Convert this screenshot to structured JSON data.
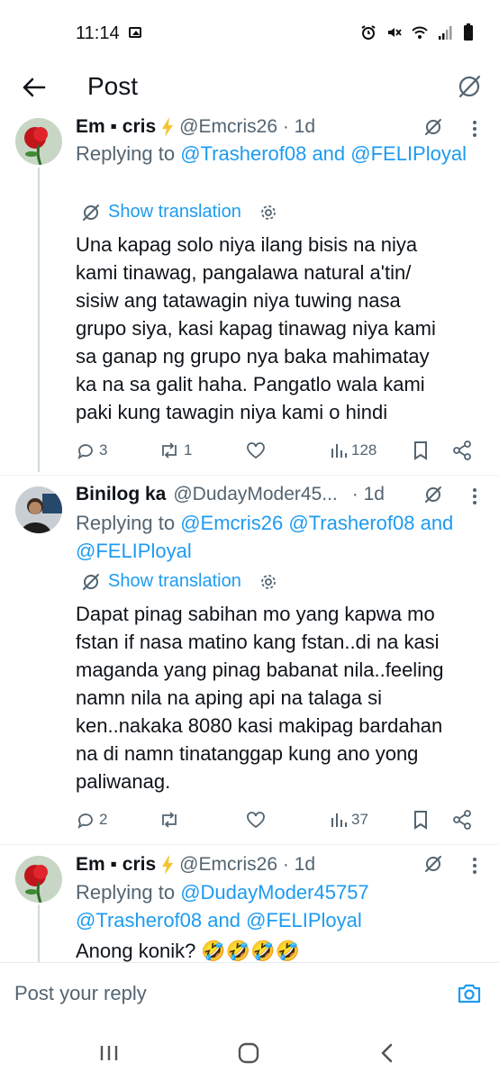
{
  "status_bar": {
    "time": "11:14"
  },
  "header": {
    "title": "Post"
  },
  "posts": [
    {
      "name": "Em ▪ cris",
      "handle": "@Emcris26 · 1d",
      "replying_prefix": "Replying to",
      "replying_users": "@Trasherof08 and @FELIPloyal",
      "show_translation": "Show translation",
      "text_lines": [
        "Una kapag solo niya ilang bisis na niya",
        "kami tinawag, pangalawa natural a'tin/",
        "sisiw ang tatawagin niya tuwing nasa",
        "grupo siya, kasi kapag tinawag niya kami",
        "sa ganap ng grupo nya baka mahimatay",
        "ka na sa galit haha. Pangatlo wala kami",
        "paki kung tawagin niya kami o hindi"
      ],
      "replies": "3",
      "reposts": "1",
      "likes": "",
      "views": "128"
    },
    {
      "name": "Binilog ka",
      "handle": "@DudayModer45...",
      "time": "· 1d",
      "replying_prefix": "Replying to",
      "replying_line1": "@Emcris26 @Trasherof08 and",
      "replying_line2": "@FELIPloyal",
      "show_translation": "Show translation",
      "text_lines": [
        "Dapat pinag sabihan mo yang kapwa mo",
        "fstan if nasa matino kang fstan..di na kasi",
        "maganda yang pinag babanat nila..feeling",
        "namn nila na aping api na talaga si",
        "ken..nakaka 8080 kasi makipag bardahan",
        "na di namn tinatanggap kung ano yong",
        "paliwanag."
      ],
      "replies": "2",
      "reposts": "",
      "likes": "",
      "views": "37"
    },
    {
      "name": "Em ▪ cris",
      "handle": "@Emcris26 · 1d",
      "replying_prefix": "Replying to",
      "replying_line1": "@DudayModer45757",
      "replying_line2": "@Trasherof08 and @FELIPloyal",
      "text": "Anong konik? 🤣🤣🤣🤣"
    }
  ],
  "composer": {
    "placeholder": "Post your reply"
  },
  "colors": {
    "link": "#1d9bf0",
    "muted": "#536471",
    "text": "#0f1419"
  }
}
